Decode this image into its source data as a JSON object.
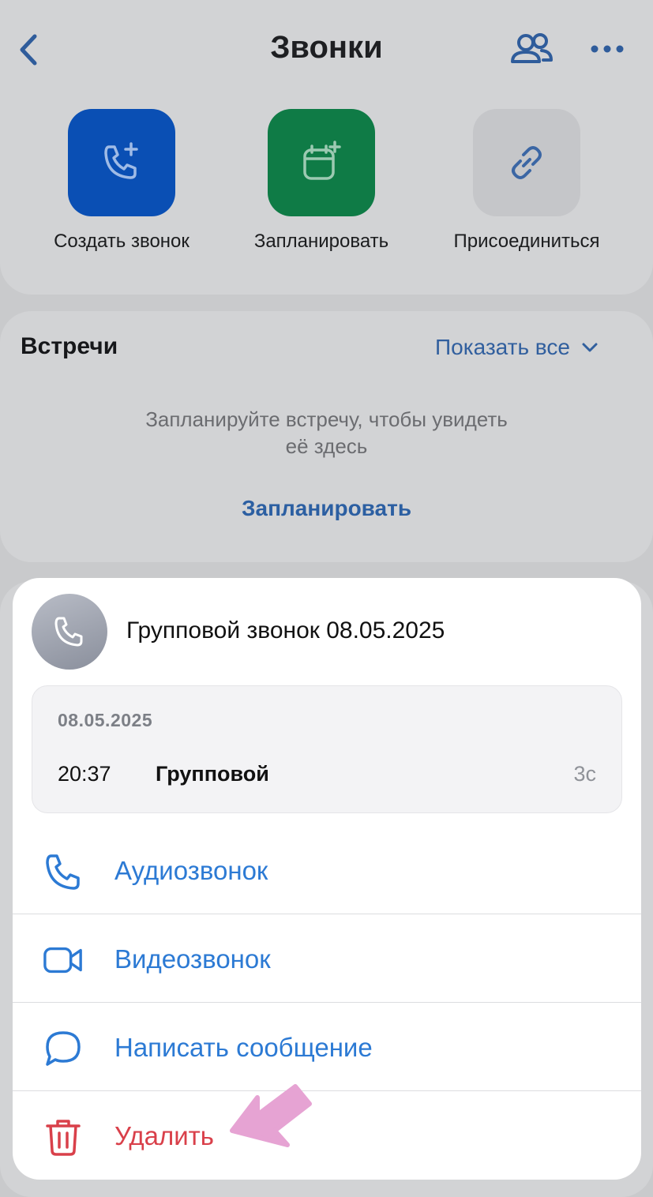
{
  "header": {
    "title": "Звонки"
  },
  "actions": [
    {
      "label": "Создать звонок",
      "color": "#0a4fb4"
    },
    {
      "label": "Запланировать",
      "color": "#0f7b46"
    },
    {
      "label": "Присоединиться",
      "color": "#c5c6c9"
    }
  ],
  "meetings": {
    "title": "Встречи",
    "show_all": "Показать все",
    "empty_line1": "Запланируйте встречу, чтобы увидеть",
    "empty_line2": "её здесь",
    "schedule_link": "Запланировать"
  },
  "sheet": {
    "call_name": "Групповой звонок 08.05.2025",
    "date": "08.05.2025",
    "time": "20:37",
    "type": "Групповой",
    "duration": "3с",
    "menu": [
      {
        "label": "Аудиозвонок",
        "icon": "phone-icon"
      },
      {
        "label": "Видеозвонок",
        "icon": "video-camera-icon"
      },
      {
        "label": "Написать сообщение",
        "icon": "message-bubble-icon"
      },
      {
        "label": "Удалить",
        "icon": "trash-icon"
      }
    ]
  },
  "colors": {
    "accent": "#2c7ad4",
    "danger": "#d9404a",
    "pointer": "#e6a3d3"
  }
}
